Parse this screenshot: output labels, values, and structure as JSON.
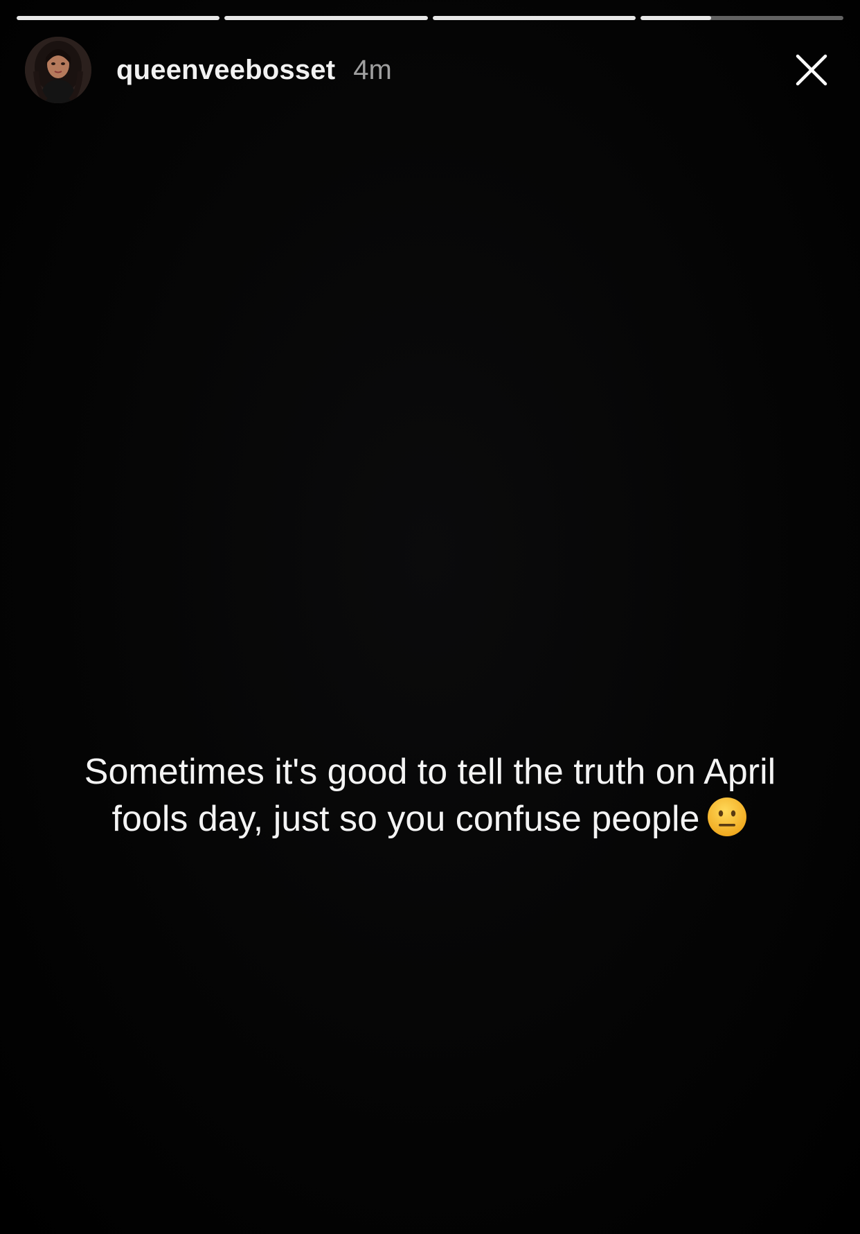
{
  "story": {
    "username": "queenveebosset",
    "timestamp": "4m",
    "avatar_icon": "profile-avatar",
    "close_icon": "close-icon",
    "progress": [
      1.0,
      1.0,
      1.0,
      0.35
    ],
    "caption": {
      "line1": "Sometimes it's good to tell the truth on April",
      "line2": "fools day, just so you confuse people",
      "emoji": "neutral-face-emoji"
    }
  },
  "colors": {
    "background": "#000000",
    "text": "#ffffff",
    "progress_filled": "#e8e8e8",
    "progress_track": "rgba(255,255,255,0.38)",
    "emoji_face": "#f5b82e"
  }
}
